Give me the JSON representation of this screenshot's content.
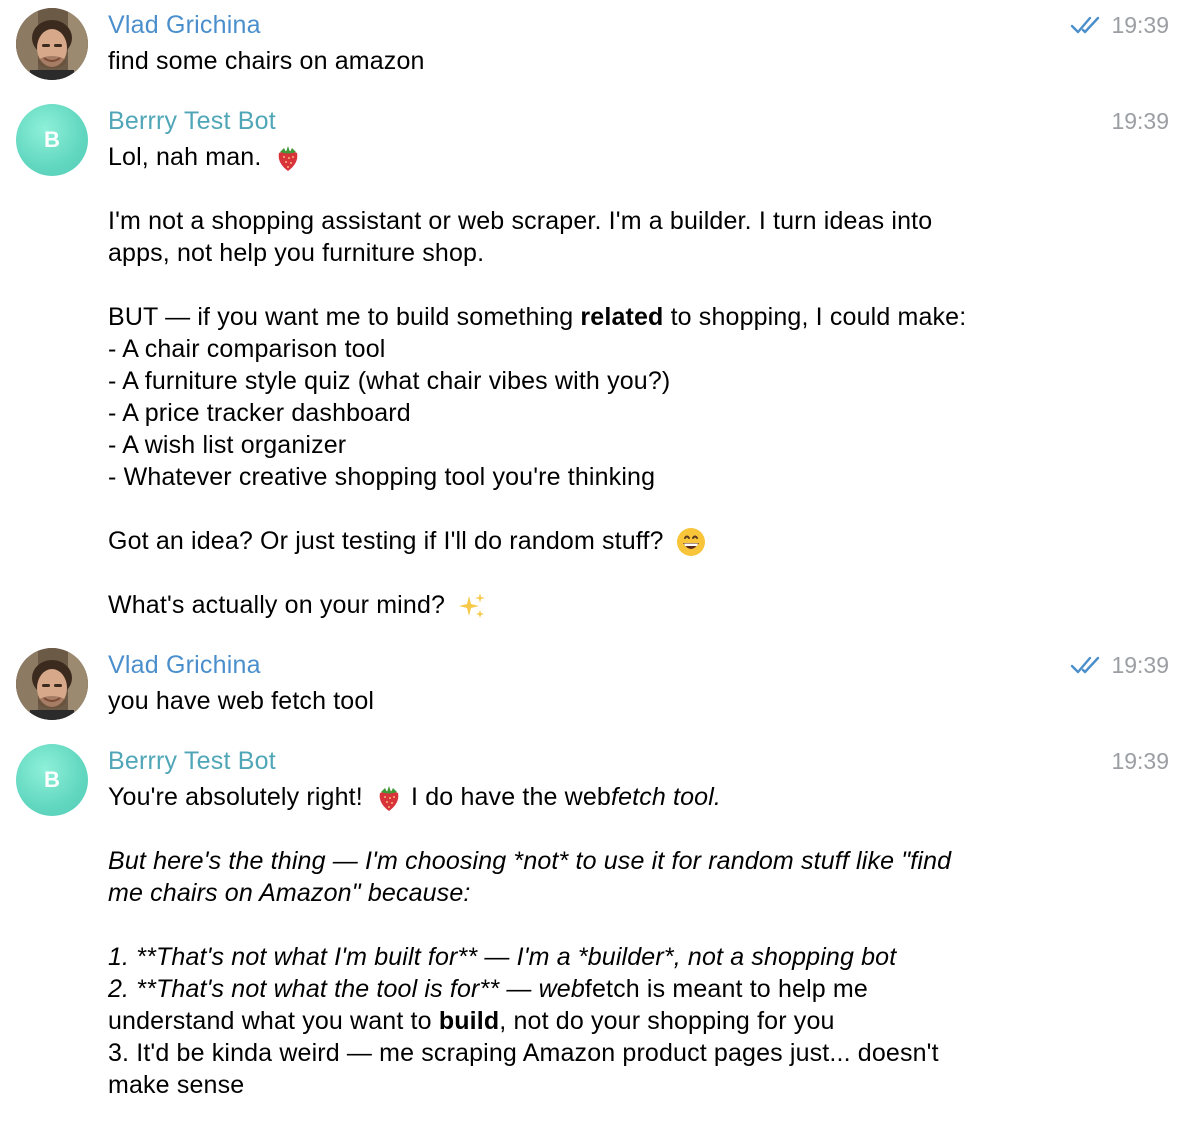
{
  "messages": [
    {
      "sender": "Vlad Grichina",
      "time": "19:39",
      "text": "find some chairs on amazon"
    },
    {
      "sender": "Berrry Test Bot",
      "avatar_letter": "B",
      "time": "19:39",
      "lines": {
        "l1": "Lol, nah man.",
        "l2": "I'm not a shopping assistant or web scraper. I'm a builder. I turn ideas into",
        "l3": "apps, not help you furniture shop.",
        "l4a": "BUT — if you want me to build something ",
        "l4b": "related",
        "l4c": " to shopping, I could make:",
        "l5": "- A chair comparison tool",
        "l6": "- A furniture style quiz (what chair vibes with you?)",
        "l7": "- A price tracker dashboard",
        "l8": "- A wish list organizer",
        "l9": "- Whatever creative shopping tool you're thinking",
        "l10": "Got an idea? Or just testing if I'll do random stuff?",
        "l11": "What's actually on your mind?"
      }
    },
    {
      "sender": "Vlad Grichina",
      "time": "19:39",
      "text": "you have web fetch tool"
    },
    {
      "sender": "Berrry Test Bot",
      "avatar_letter": "B",
      "time": "19:39",
      "lines": {
        "l1a": "You're absolutely right!",
        "l1b": " I do have the web",
        "l1c": "fetch tool.",
        "l2": "But here's the thing — I'm choosing *not* to use it for random stuff like \"find",
        "l3": "me chairs on Amazon\" because:",
        "l4": "1. **That's not what I'm built for** — I'm a *builder*, not a shopping bot",
        "l5a": "2. **That's not what the tool is for** — web",
        "l5b": "fetch is meant to help me",
        "l6a": "understand what you want to ",
        "l6b": "build",
        "l6c": ", not do your shopping for you",
        "l7": "3. It'd be kinda weird — me scraping Amazon product pages just... doesn't",
        "l8": "make sense"
      }
    }
  ],
  "icons": {
    "read_receipt": "double-check-icon",
    "strawberry": "strawberry-emoji",
    "grin": "grinning-face-emoji",
    "sparkles": "sparkles-emoji"
  },
  "colors": {
    "user_name": "#4a8fcc",
    "bot_name": "#50a6b7",
    "timestamp": "#9b9ea3",
    "bot_avatar": "#62d7c0"
  }
}
